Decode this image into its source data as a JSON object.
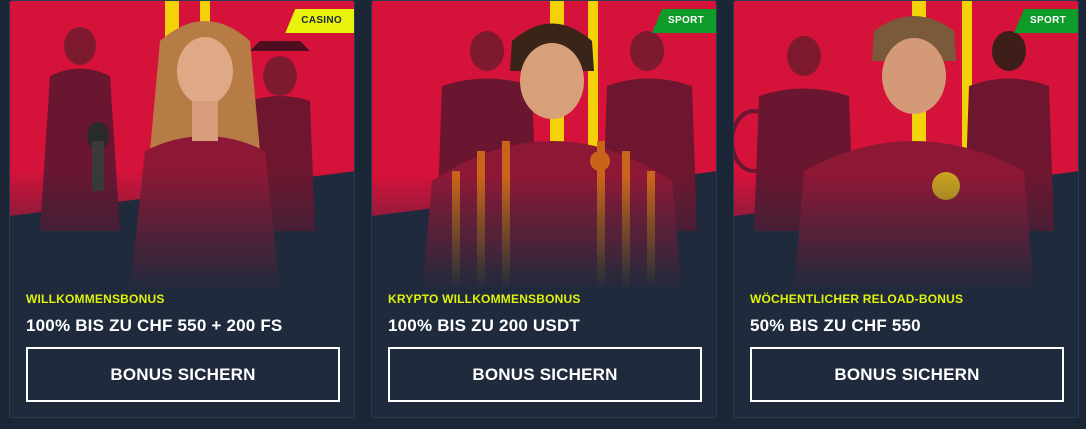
{
  "cards": [
    {
      "badge": "CASINO",
      "badge_color": "#e9f20b",
      "kicker": "WILLKOMMENSBONUS",
      "offer": "100% BIS ZU CHF 550 + 200 FS",
      "cta": "BONUS SICHERN"
    },
    {
      "badge": "SPORT",
      "badge_color": "#0d9b2a",
      "kicker": "KRYPTO WILLKOMMENSBONUS",
      "offer": "100% BIS ZU 200 USDT",
      "cta": "BONUS SICHERN"
    },
    {
      "badge": "SPORT",
      "badge_color": "#0d9b2a",
      "kicker": "WÖCHENTLICHER RELOAD-BONUS",
      "offer": "50% BIS ZU CHF 550",
      "cta": "BONUS SICHERN"
    }
  ],
  "colors": {
    "page_bg": "#1b2637",
    "hero_red": "#d4123a",
    "stripe_yellow": "#f3d20a",
    "kicker_yellow": "#dff20a"
  }
}
